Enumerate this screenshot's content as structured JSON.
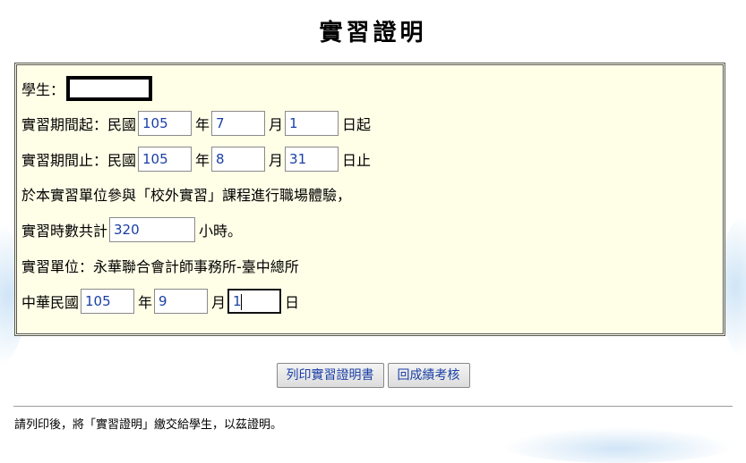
{
  "page": {
    "title": "實習證明"
  },
  "form": {
    "student_label": "學生：",
    "period_start": {
      "label": "實習期間起：民國",
      "year": "105",
      "year_unit": "年",
      "month": "7",
      "month_unit": "月",
      "day": "1",
      "day_unit": "日起"
    },
    "period_end": {
      "label": "實習期間止：民國",
      "year": "105",
      "year_unit": "年",
      "month": "8",
      "month_unit": "月",
      "day": "31",
      "day_unit": "日止"
    },
    "statement": "於本實習單位參與「校外實習」課程進行職場體驗，",
    "hours": {
      "label": "實習時數共計",
      "value": "320",
      "unit": "小時。"
    },
    "unit_line": "實習單位：永華聯合會計師事務所-臺中總所",
    "issue_date": {
      "label": "中華民國",
      "year": "105",
      "year_unit": "年",
      "month": "9",
      "month_unit": "月",
      "day": "1",
      "day_unit": "日"
    }
  },
  "buttons": {
    "print": "列印實習證明書",
    "back": "回成績考核"
  },
  "footer": {
    "note": "請列印後，將「實習證明」繳交給學生，以茲證明。"
  },
  "colors": {
    "panel_bg": "#ffffe8",
    "field_text": "#1a3fa6",
    "button_text": "#1a3fa6"
  }
}
